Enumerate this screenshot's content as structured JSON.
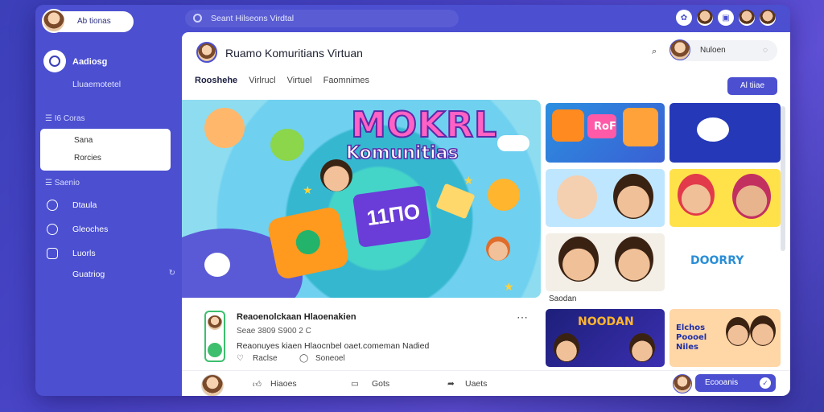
{
  "topbar": {
    "user_label": "Ab tionas",
    "search_text": "Seant Hilseons Virdtal"
  },
  "sidebar": {
    "brand_title": "Aadiosg",
    "brand_subtitle": "Lluaemotetel",
    "section1": "I6 Coras",
    "sub_items": [
      "Sana",
      "Rorcies"
    ],
    "section2": "Saenio",
    "nav_items": [
      {
        "label": "Dtaula",
        "icon": "globe-icon"
      },
      {
        "label": "Gleoches",
        "icon": "compass-icon"
      },
      {
        "label": "Luorls",
        "icon": "lock-icon"
      },
      {
        "label": "Guatriog",
        "icon": "refresh-icon"
      }
    ]
  },
  "main": {
    "title": "Ruamo Komuritians Virtuan",
    "profile_label": "Nuloen",
    "tabs": [
      "Rooshehe",
      "Virlrucl",
      "Virtuel",
      "Faomnimes"
    ],
    "action_button": "Al tiiae",
    "hero": {
      "logo_top": "MOKRL",
      "logo_sub": "Komunitias",
      "badge": "11ΠΟ"
    },
    "post": {
      "name": "Reaoenolckaan Hlaoenakien",
      "meta": "Seae 3809 S900 2 C",
      "body": "Reaonuyes kiaen Hlaocnbel oaet.comeman Nadied",
      "like_label": "Raclse",
      "comment_label": "Soneoel"
    },
    "bottom": {
      "likes_label": "Hiaoes",
      "comments_label": "Gots",
      "share_label": "Uaets",
      "cta_button": "Ecooanis"
    },
    "grid": {
      "tile1_label": "RoF",
      "tile7_label": "DOORRY",
      "caption": "Saodan",
      "tile9_label": "NOODAN",
      "tile10_label": "Elchos Poooel Niles"
    }
  }
}
